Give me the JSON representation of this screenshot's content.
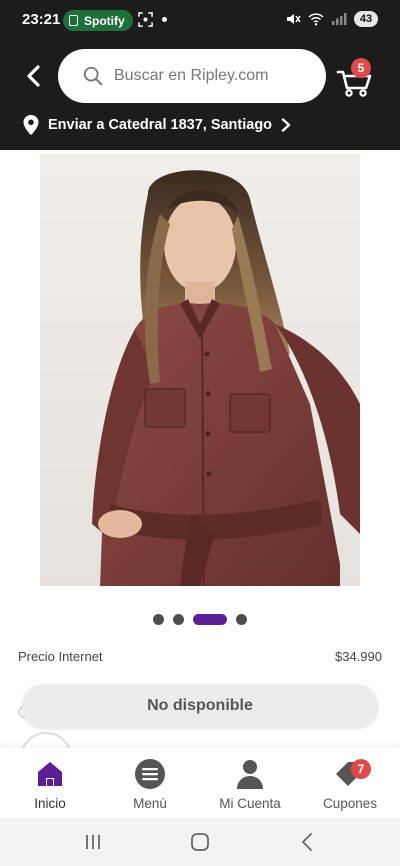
{
  "status_bar": {
    "time": "23:21",
    "spotify_label": "Spotify",
    "battery": "43"
  },
  "header": {
    "search_placeholder": "Buscar en Ripley.com",
    "cart_count": "5",
    "delivery_location": "Enviar a Catedral  1837, Santiago"
  },
  "product": {
    "price_label": "Precio Internet",
    "price_value": "$34.990",
    "availability_button": "No disponible",
    "carousel": {
      "total": 4,
      "active_index": 2
    }
  },
  "bottom_nav": {
    "items": [
      {
        "label": "Inicio",
        "icon": "home-icon",
        "active": true
      },
      {
        "label": "Menú",
        "icon": "menu-icon",
        "active": false
      },
      {
        "label": "Mi Cuenta",
        "icon": "account-icon",
        "active": false
      },
      {
        "label": "Cupones",
        "icon": "coupon-icon",
        "active": false
      }
    ],
    "coupon_count": "7"
  },
  "colors": {
    "header_bg": "#1c1c1c",
    "brand_purple": "#5b1f96",
    "badge_red": "#e04a4a",
    "spotify_green": "#1f6f3a"
  }
}
